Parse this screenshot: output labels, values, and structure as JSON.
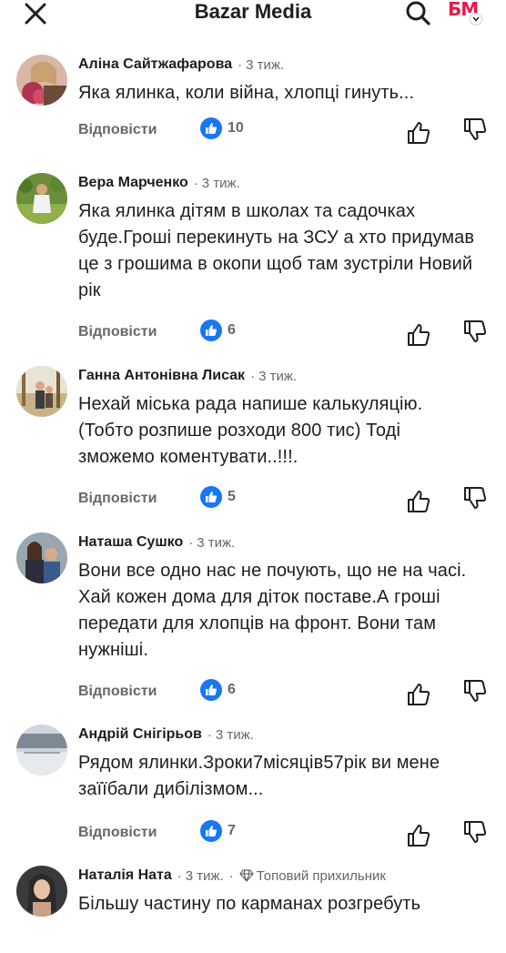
{
  "header": {
    "title": "Bazar Media",
    "close_icon": "close-icon",
    "search_icon": "search-icon",
    "logo_text": "БМ"
  },
  "colors": {
    "like_blue": "#1877f2",
    "secondary_text": "#65676b",
    "brand": "#e6194b"
  },
  "comments": [
    {
      "author": "Аліна Сайтжафарова",
      "time": "3 тиж.",
      "text": "Яка ялинка, коли війна, хлопці гинуть...",
      "reply_label": "Відповісти",
      "likes": "10"
    },
    {
      "author": "Вера Марченко",
      "time": "3 тиж.",
      "text": "Яка ялинка дітям в школах та садочках буде.Гроші перекинуть на ЗСУ а хто придумав це з грошима  в окопи щоб там зустріли Новий рік",
      "reply_label": "Відповісти",
      "likes": "6"
    },
    {
      "author": "Ганна Антонівна Лисак",
      "time": "3 тиж.",
      "text": "Нехай міська рада напише калькуляцію. (Тобто розпише розходи 800 тис) Тоді зможемо коментувати..!!!.",
      "reply_label": "Відповісти",
      "likes": "5"
    },
    {
      "author": "Наташа Сушко",
      "time": "3 тиж.",
      "text": "Вони все одно нас не почують, що не на часі. Хай кожен дома для діток поставе.А гроші передати для хлопців на фронт. Вони там нужніші.",
      "reply_label": "Відповісти",
      "likes": "6"
    },
    {
      "author": "Андрій Снігірьов",
      "time": "3 тиж.",
      "text": "Рядом ялинки.Зроки7місяців57рік ви мене заїїбали дибілізмом...",
      "reply_label": "Відповісти",
      "likes": "7"
    },
    {
      "author": "Наталія Ната",
      "time": "3 тиж.",
      "badge": "Топовий прихильник",
      "text": "Більшу частину по карманах розгребуть"
    }
  ]
}
